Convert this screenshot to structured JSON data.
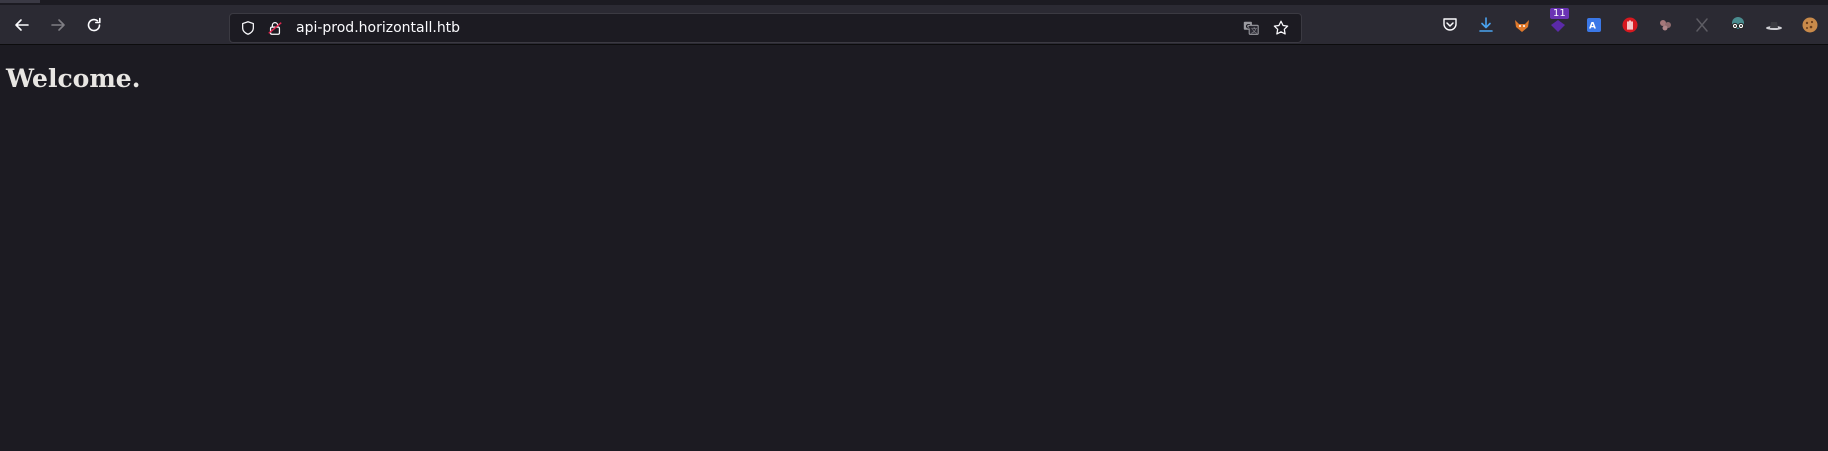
{
  "browser": {
    "url": "api-prod.horizontall.htb",
    "icons": {
      "back": "back-arrow-icon",
      "forward": "forward-arrow-icon",
      "reload": "reload-icon",
      "shield": "tracking-protection-shield-icon",
      "lock": "insecure-lock-icon",
      "translate": "translate-icon",
      "bookmark": "bookmark-star-icon"
    },
    "extensions": [
      {
        "name": "pocket-icon"
      },
      {
        "name": "downloads-icon"
      },
      {
        "name": "foxyproxy-icon"
      },
      {
        "name": "hack-tools-icon",
        "badge": "11"
      },
      {
        "name": "google-translate-icon"
      },
      {
        "name": "ublock-hand-icon"
      },
      {
        "name": "cookie-editor-icon"
      },
      {
        "name": "x-icon"
      },
      {
        "name": "glasses-spy-icon"
      },
      {
        "name": "hat-icon"
      },
      {
        "name": "cookie-icon"
      }
    ]
  },
  "page": {
    "heading": "Welcome."
  }
}
